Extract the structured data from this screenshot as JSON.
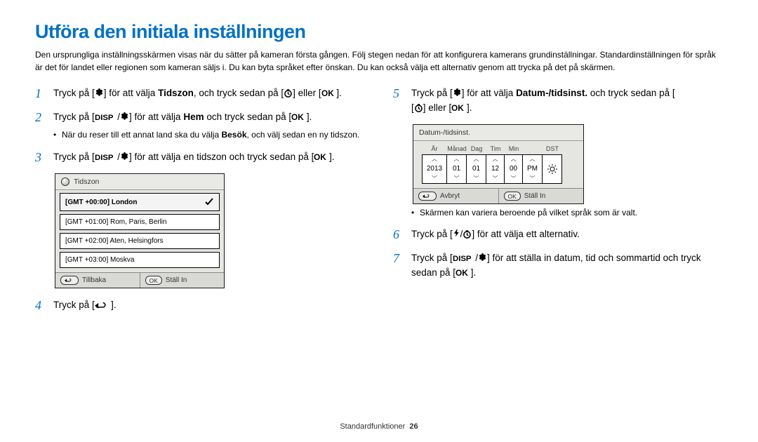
{
  "title": "Utföra den initiala inställningen",
  "intro": "Den ursprungliga inställningsskärmen visas när du sätter på kameran första gången. Följ stegen nedan för att konfigurera kamerans grundinställningar. Standardinställningen för språk är det för landet eller regionen som kameran säljs i. Du kan byta språket efter önskan. Du kan också välja ett alternativ genom att trycka på det på skärmen.",
  "steps": {
    "1a": "Tryck på [",
    "1b": "] för att välja ",
    "1c": "Tidszon",
    "1d": ", och tryck sedan på [",
    "1e": "] eller [",
    "1f": "].",
    "2a": "Tryck på [",
    "2b": "/",
    "2c": "] för att välja ",
    "2d": "Hem",
    "2e": " och tryck sedan på [",
    "2f": "].",
    "2sub_a": "När du reser till ett annat land ska du välja ",
    "2sub_b": "Besök",
    "2sub_c": ", och välj sedan en ny tidszon.",
    "3a": "Tryck på [",
    "3b": "/",
    "3c": "] för att välja en tidszon och tryck sedan på [",
    "3d": "].",
    "4a": "Tryck på [",
    "4b": "].",
    "5a": "Tryck på [",
    "5b": "] för att välja ",
    "5c": "Datum-/tidsinst.",
    "5d": " och tryck sedan på [",
    "5e": "] eller [",
    "5f": "].",
    "5sub": "Skärmen kan variera beroende på vilket språk som är valt.",
    "6a": "Tryck på [",
    "6b": "/",
    "6c": "] för att välja ett alternativ.",
    "7a": "Tryck på [",
    "7b": "/",
    "7c": "] för att ställa in datum, tid och sommartid och tryck sedan på [",
    "7d": "]."
  },
  "tz": {
    "title": "Tidszon",
    "items": [
      "[GMT +00:00] London",
      "[GMT +01:00] Rom, Paris, Berlin",
      "[GMT +02:00] Aten, Helsingfors",
      "[GMT +03:00] Moskva"
    ],
    "back_label": "Tillbaka",
    "ok_key": "OK",
    "set_label": "Ställ In"
  },
  "dt": {
    "title": "Datum-/tidsinst.",
    "labels": [
      "År",
      "Månad",
      "Dag",
      "Tim",
      "Min",
      "",
      "DST"
    ],
    "values": [
      "2013",
      "01",
      "01",
      "12",
      "00",
      "PM",
      ""
    ],
    "cancel_label": "Avbryt",
    "ok_key": "OK",
    "set_label": "Ställ In"
  },
  "footer_section": "Standardfunktioner",
  "footer_page": "26"
}
